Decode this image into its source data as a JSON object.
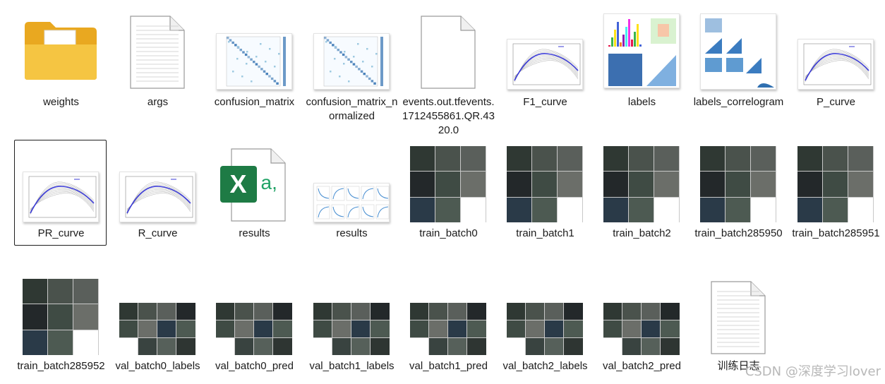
{
  "files": [
    {
      "name": "weights",
      "kind": "folder"
    },
    {
      "name": "args",
      "kind": "text"
    },
    {
      "name": "confusion_matrix",
      "kind": "matrix"
    },
    {
      "name": "confusion_matrix_normalized",
      "kind": "matrix"
    },
    {
      "name": "events.out.tfevents.1712455861.QR.4320.0",
      "kind": "blank"
    },
    {
      "name": "F1_curve",
      "kind": "curve"
    },
    {
      "name": "labels",
      "kind": "labels"
    },
    {
      "name": "labels_correlogram",
      "kind": "correlogram"
    },
    {
      "name": "P_curve",
      "kind": "curve"
    },
    {
      "name": "PR_curve",
      "kind": "curve",
      "selected": true
    },
    {
      "name": "R_curve",
      "kind": "curve"
    },
    {
      "name": "results",
      "kind": "excel",
      "excel_glyph": "X",
      "excel_suffix": "a,"
    },
    {
      "name": "results",
      "kind": "results"
    },
    {
      "name": "train_batch0",
      "kind": "mosaic"
    },
    {
      "name": "train_batch1",
      "kind": "mosaic"
    },
    {
      "name": "train_batch2",
      "kind": "mosaic"
    },
    {
      "name": "train_batch285950",
      "kind": "mosaic"
    },
    {
      "name": "train_batch285951",
      "kind": "mosaic"
    },
    {
      "name": "train_batch285952",
      "kind": "mosaic"
    },
    {
      "name": "val_batch0_labels",
      "kind": "val"
    },
    {
      "name": "val_batch0_pred",
      "kind": "val"
    },
    {
      "name": "val_batch1_labels",
      "kind": "val"
    },
    {
      "name": "val_batch1_pred",
      "kind": "val"
    },
    {
      "name": "val_batch2_labels",
      "kind": "val"
    },
    {
      "name": "val_batch2_pred",
      "kind": "val"
    },
    {
      "name": "训练日志",
      "kind": "text"
    }
  ],
  "watermark": "CSDN @深度学习lover",
  "colors": {
    "folder": "#f5c542",
    "excel": "#1e7b45",
    "curve_line": "#3b3bd6",
    "matrix": "#2f6fb0",
    "selection_border": "#1f1f1f"
  }
}
